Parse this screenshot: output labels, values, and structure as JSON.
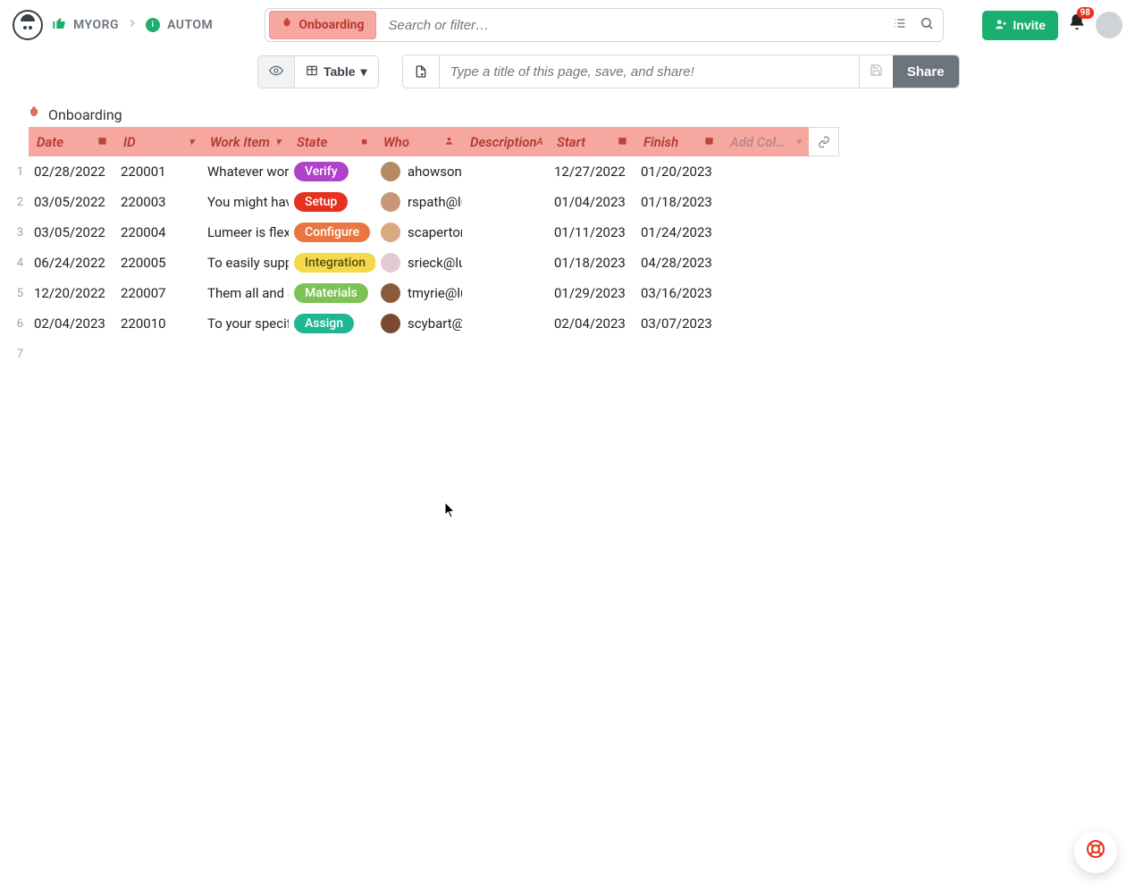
{
  "breadcrumbs": {
    "org": "MYORG",
    "project": "AUTOM"
  },
  "search": {
    "pill_label": "Onboarding",
    "placeholder": "Search or filter…"
  },
  "header": {
    "invite_label": "Invite",
    "notification_count": "98"
  },
  "toolbar": {
    "view_label": "Table",
    "title_placeholder": "Type a title of this page, save, and share!",
    "share_label": "Share"
  },
  "table": {
    "title": "Onboarding",
    "columns": [
      "Date",
      "ID",
      "Work Item",
      "State",
      "Who",
      "Description",
      "Start",
      "Finish"
    ],
    "add_column_label": "Add Col…",
    "column_icons": [
      "calendar",
      "caret",
      "caret",
      "square",
      "user",
      "text",
      "calendar",
      "calendar"
    ],
    "state_colors": {
      "Verify": "#b041c9",
      "Setup": "#e5311d",
      "Configure": "#ec7642",
      "Integration": "#f4d94b",
      "Materials": "#7cc254",
      "Assign": "#1fb695"
    },
    "state_text_colors": {
      "Integration": "#5a4f12"
    },
    "avatar_colors": [
      "#b58a63",
      "#c9967a",
      "#d9a97f",
      "#e3c9d4",
      "#8a5a3a",
      "#7a4a30"
    ],
    "rows": [
      {
        "n": "1",
        "date": "02/28/2022",
        "id": "220001",
        "work": "Whatever wor",
        "state": "Verify",
        "who": "ahowson@",
        "desc": "",
        "start": "12/27/2022",
        "finish": "01/20/2023"
      },
      {
        "n": "2",
        "date": "03/05/2022",
        "id": "220003",
        "work": "You might hav",
        "state": "Setup",
        "who": "rspath@lu",
        "desc": "",
        "start": "01/04/2023",
        "finish": "01/18/2023"
      },
      {
        "n": "3",
        "date": "03/05/2022",
        "id": "220004",
        "work": "Lumeer is flex",
        "state": "Configure",
        "who": "scapertor",
        "desc": "",
        "start": "01/11/2023",
        "finish": "01/24/2023"
      },
      {
        "n": "4",
        "date": "06/24/2022",
        "id": "220005",
        "work": "To easily supp",
        "state": "Integration",
        "who": "srieck@lu",
        "desc": "",
        "start": "01/18/2023",
        "finish": "04/28/2023"
      },
      {
        "n": "5",
        "date": "12/20/2022",
        "id": "220007",
        "work": "Them all and a",
        "state": "Materials",
        "who": "tmyrie@lu",
        "desc": "",
        "start": "01/29/2023",
        "finish": "03/16/2023"
      },
      {
        "n": "6",
        "date": "02/04/2023",
        "id": "220010",
        "work": "To your specif",
        "state": "Assign",
        "who": "scybart@",
        "desc": "",
        "start": "02/04/2023",
        "finish": "03/07/2023"
      }
    ],
    "empty_row_num": "7"
  }
}
